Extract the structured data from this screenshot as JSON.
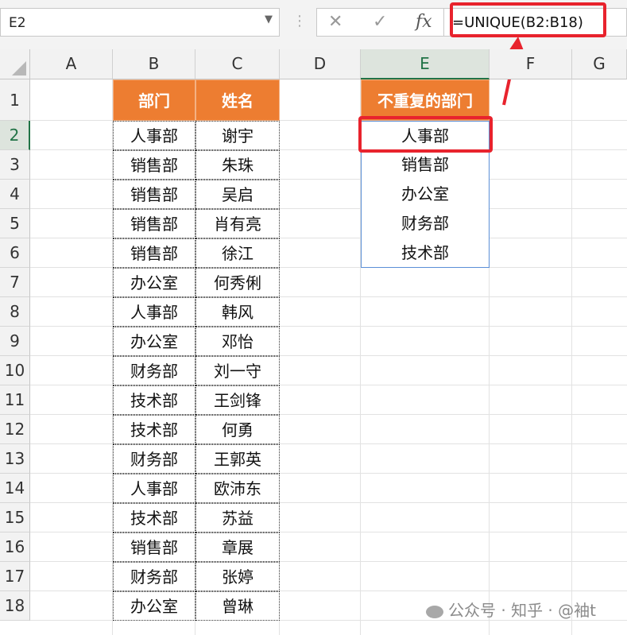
{
  "name_box": "E2",
  "formula_bar": {
    "cancel_icon": "✕",
    "enter_icon": "✓",
    "fx_icon": "fx",
    "formula": "=UNIQUE(B2:B18)"
  },
  "columns": [
    "A",
    "B",
    "C",
    "D",
    "E",
    "F",
    "G"
  ],
  "rows": [
    "1",
    "2",
    "3",
    "4",
    "5",
    "6",
    "7",
    "8",
    "9",
    "10",
    "11",
    "12",
    "13",
    "14",
    "15",
    "16",
    "17",
    "18"
  ],
  "table": {
    "headers": [
      "部门",
      "姓名"
    ],
    "rows": [
      [
        "人事部",
        "谢宇"
      ],
      [
        "销售部",
        "朱珠"
      ],
      [
        "销售部",
        "吴启"
      ],
      [
        "销售部",
        "肖有亮"
      ],
      [
        "销售部",
        "徐江"
      ],
      [
        "办公室",
        "何秀俐"
      ],
      [
        "人事部",
        "韩风"
      ],
      [
        "办公室",
        "邓怡"
      ],
      [
        "财务部",
        "刘一守"
      ],
      [
        "技术部",
        "王剑锋"
      ],
      [
        "技术部",
        "何勇"
      ],
      [
        "财务部",
        "王郭英"
      ],
      [
        "人事部",
        "欧沛东"
      ],
      [
        "技术部",
        "苏益"
      ],
      [
        "销售部",
        "章展"
      ],
      [
        "财务部",
        "张婷"
      ],
      [
        "办公室",
        "曾琳"
      ]
    ]
  },
  "unique": {
    "header": "不重复的部门",
    "values": [
      "人事部",
      "销售部",
      "办公室",
      "财务部",
      "技术部"
    ]
  },
  "watermark": "公众号 · 知乎 · @袖t",
  "colors": {
    "header_fill": "#ed7d31",
    "highlight": "#e8232d",
    "selected": "#217346"
  }
}
